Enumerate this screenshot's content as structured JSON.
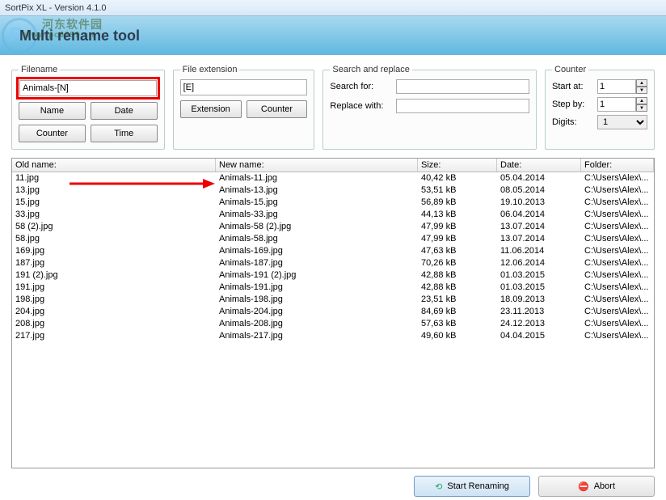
{
  "window": {
    "title": "SortPix XL - Version 4.1.0"
  },
  "watermark": {
    "site": "河东软件园",
    "url": "www.pc0359.cn"
  },
  "header": {
    "title": "Multi rename tool"
  },
  "filename": {
    "legend": "Filename",
    "value": "Animals-[N]",
    "btn_name": "Name",
    "btn_date": "Date",
    "btn_counter": "Counter",
    "btn_time": "Time"
  },
  "ext": {
    "legend": "File extension",
    "value": "[E]",
    "btn_extension": "Extension",
    "btn_counter": "Counter"
  },
  "search": {
    "legend": "Search and replace",
    "searchfor_label": "Search for:",
    "searchfor_value": "",
    "replacewith_label": "Replace with:",
    "replacewith_value": ""
  },
  "counter": {
    "legend": "Counter",
    "start_label": "Start at:",
    "start_value": "1",
    "step_label": "Step by:",
    "step_value": "1",
    "digits_label": "Digits:",
    "digits_value": "1"
  },
  "table": {
    "columns": {
      "old": "Old name:",
      "new": "New name:",
      "size": "Size:",
      "date": "Date:",
      "folder": "Folder:"
    },
    "rows": [
      {
        "old": "11.jpg",
        "new": "Animals-11.jpg",
        "size": "40,42 kB",
        "date": "05.04.2014",
        "folder": "C:\\Users\\Alex\\..."
      },
      {
        "old": "13.jpg",
        "new": "Animals-13.jpg",
        "size": "53,51 kB",
        "date": "08.05.2014",
        "folder": "C:\\Users\\Alex\\..."
      },
      {
        "old": "15.jpg",
        "new": "Animals-15.jpg",
        "size": "56,89 kB",
        "date": "19.10.2013",
        "folder": "C:\\Users\\Alex\\..."
      },
      {
        "old": "33.jpg",
        "new": "Animals-33.jpg",
        "size": "44,13 kB",
        "date": "06.04.2014",
        "folder": "C:\\Users\\Alex\\..."
      },
      {
        "old": "58 (2).jpg",
        "new": "Animals-58 (2).jpg",
        "size": "47,99 kB",
        "date": "13.07.2014",
        "folder": "C:\\Users\\Alex\\..."
      },
      {
        "old": "58.jpg",
        "new": "Animals-58.jpg",
        "size": "47,99 kB",
        "date": "13.07.2014",
        "folder": "C:\\Users\\Alex\\..."
      },
      {
        "old": "169.jpg",
        "new": "Animals-169.jpg",
        "size": "47,63 kB",
        "date": "11.06.2014",
        "folder": "C:\\Users\\Alex\\..."
      },
      {
        "old": "187.jpg",
        "new": "Animals-187.jpg",
        "size": "70,26 kB",
        "date": "12.06.2014",
        "folder": "C:\\Users\\Alex\\..."
      },
      {
        "old": "191 (2).jpg",
        "new": "Animals-191 (2).jpg",
        "size": "42,88 kB",
        "date": "01.03.2015",
        "folder": "C:\\Users\\Alex\\..."
      },
      {
        "old": "191.jpg",
        "new": "Animals-191.jpg",
        "size": "42,88 kB",
        "date": "01.03.2015",
        "folder": "C:\\Users\\Alex\\..."
      },
      {
        "old": "198.jpg",
        "new": "Animals-198.jpg",
        "size": "23,51 kB",
        "date": "18.09.2013",
        "folder": "C:\\Users\\Alex\\..."
      },
      {
        "old": "204.jpg",
        "new": "Animals-204.jpg",
        "size": "84,69 kB",
        "date": "23.11.2013",
        "folder": "C:\\Users\\Alex\\..."
      },
      {
        "old": "208.jpg",
        "new": "Animals-208.jpg",
        "size": "57,63 kB",
        "date": "24.12.2013",
        "folder": "C:\\Users\\Alex\\..."
      },
      {
        "old": "217.jpg",
        "new": "Animals-217.jpg",
        "size": "49,60 kB",
        "date": "04.04.2015",
        "folder": "C:\\Users\\Alex\\..."
      }
    ]
  },
  "footer": {
    "start": "Start Renaming",
    "abort": "Abort"
  }
}
